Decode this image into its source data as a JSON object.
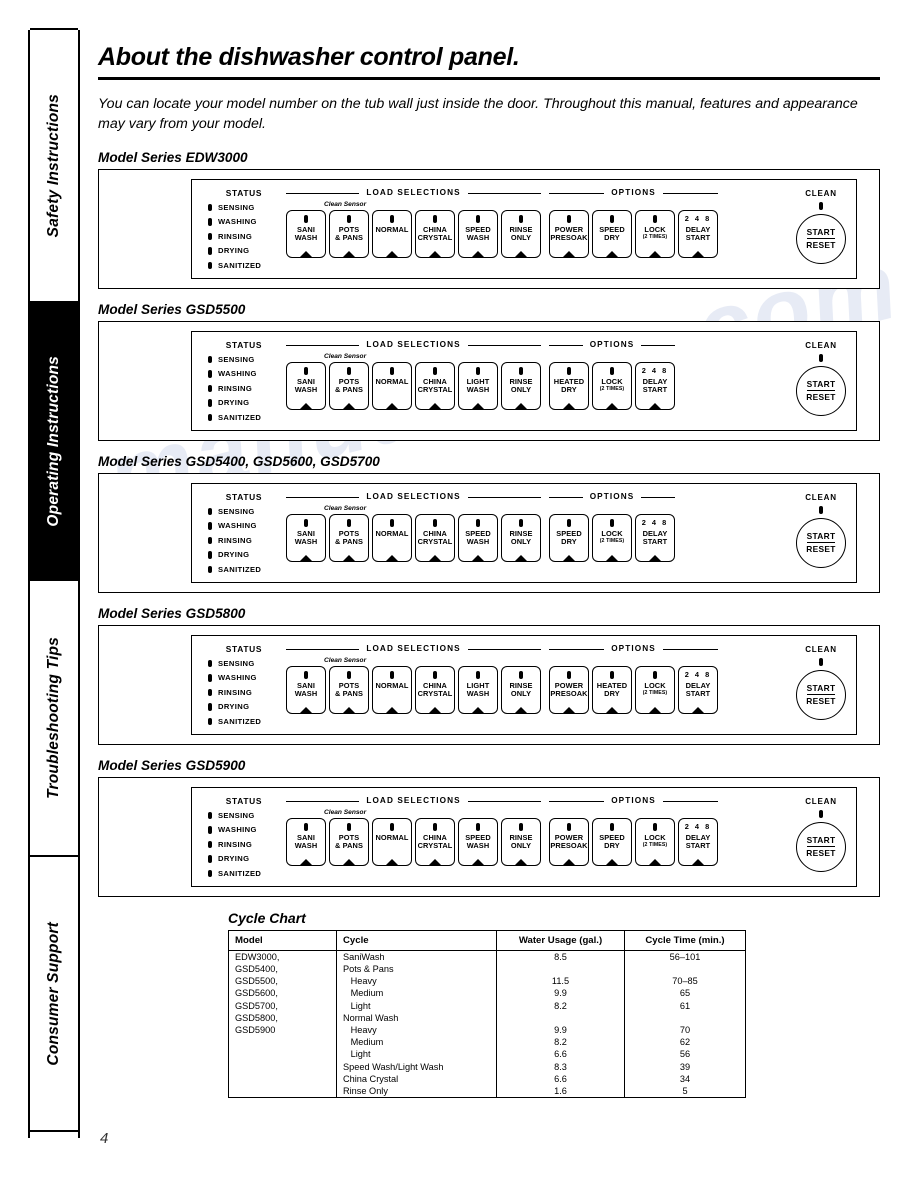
{
  "sidebar": {
    "tabs": [
      {
        "label": "Safety Instructions",
        "active": false
      },
      {
        "label": "Operating Instructions",
        "active": true
      },
      {
        "label": "Troubleshooting Tips",
        "active": false
      },
      {
        "label": "Consumer Support",
        "active": false
      }
    ]
  },
  "header": {
    "title": "About the dishwasher control panel.",
    "intro": "You can locate your model number on the tub wall just inside the door. Throughout this manual, features and appearance may vary from your model."
  },
  "common": {
    "status_title": "STATUS",
    "status_items": [
      "SENSING",
      "WASHING",
      "RINSING",
      "DRYING",
      "SANITIZED"
    ],
    "load_selections_title": "LOAD SELECTIONS",
    "options_title": "OPTIONS",
    "clean_sensor_label": "Clean Sensor",
    "clean_label": "CLEAN",
    "start_label": "START",
    "reset_label": "RESET",
    "delay_digits": "2 4 8",
    "lock_sub": "(2 TIMES)"
  },
  "panels": [
    {
      "heading": "Model Series EDW3000",
      "load": [
        "SANI\nWASH",
        "POTS\n& PANS",
        "NORMAL",
        "CHINA\nCRYSTAL",
        "SPEED\nWASH",
        "RINSE\nONLY"
      ],
      "options": [
        "POWER\nPRESOAK",
        "SPEED\nDRY",
        "LOCK",
        "DELAY\nSTART"
      ]
    },
    {
      "heading": "Model Series GSD5500",
      "load": [
        "SANI\nWASH",
        "POTS\n& PANS",
        "NORMAL",
        "CHINA\nCRYSTAL",
        "LIGHT\nWASH",
        "RINSE\nONLY"
      ],
      "options": [
        "HEATED\nDRY",
        "LOCK",
        "DELAY\nSTART"
      ]
    },
    {
      "heading": "Model Series GSD5400, GSD5600, GSD5700",
      "load": [
        "SANI\nWASH",
        "POTS\n& PANS",
        "NORMAL",
        "CHINA\nCRYSTAL",
        "SPEED\nWASH",
        "RINSE\nONLY"
      ],
      "options": [
        "SPEED\nDRY",
        "LOCK",
        "DELAY\nSTART"
      ]
    },
    {
      "heading": "Model Series GSD5800",
      "load": [
        "SANI\nWASH",
        "POTS\n& PANS",
        "NORMAL",
        "CHINA\nCRYSTAL",
        "LIGHT\nWASH",
        "RINSE\nONLY"
      ],
      "options": [
        "POWER\nPRESOAK",
        "HEATED\nDRY",
        "LOCK",
        "DELAY\nSTART"
      ]
    },
    {
      "heading": "Model Series GSD5900",
      "load": [
        "SANI\nWASH",
        "POTS\n& PANS",
        "NORMAL",
        "CHINA\nCRYSTAL",
        "SPEED\nWASH",
        "RINSE\nONLY"
      ],
      "options": [
        "POWER\nPRESOAK",
        "SPEED\nDRY",
        "LOCK",
        "DELAY\nSTART"
      ]
    }
  ],
  "cycle_chart": {
    "title": "Cycle Chart",
    "columns": [
      "Model",
      "Cycle",
      "Water Usage (gal.)",
      "Cycle Time (min.)"
    ],
    "model_lines": [
      "EDW3000,",
      "GSD5400,",
      "GSD5500,",
      "GSD5600,",
      "GSD5700,",
      "GSD5800,",
      "GSD5900"
    ],
    "cycle_lines": [
      "SaniWash",
      "Pots & Pans",
      "   Heavy",
      "   Medium",
      "   Light",
      "Normal Wash",
      "   Heavy",
      "   Medium",
      "   Light",
      "Speed Wash/Light Wash",
      "China Crystal",
      "Rinse Only"
    ],
    "water_lines": [
      "8.5",
      "",
      "11.5",
      "9.9",
      "8.2",
      "",
      "9.9",
      "8.2",
      "6.6",
      "8.3",
      "6.6",
      "1.6"
    ],
    "time_lines": [
      "56–101",
      "",
      "70–85",
      "65",
      "61",
      "",
      "70",
      "62",
      "56",
      "39",
      "34",
      "5"
    ]
  },
  "footer": {
    "page_number": "4"
  },
  "watermark": {
    "text": "manualslive.com"
  }
}
